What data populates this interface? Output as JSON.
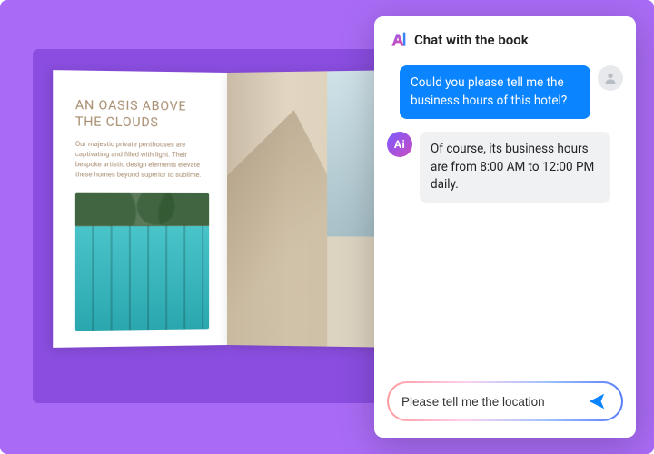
{
  "book": {
    "title": "AN OASIS ABOVE THE CLOUDS",
    "body": "Our majestic private penthouses are captivating and filled with light. Their bespoke artistic design elements elevate these homes beyond superior to sublime."
  },
  "chat": {
    "title": "Chat with the book",
    "messages": {
      "user1": "Could you please tell me the business hours of this hotel?",
      "ai1": "Of course, its business hours are from 8:00 AM to 12:00 PM daily."
    },
    "input_value": "Please tell me the location",
    "ai_badge": "Ai"
  },
  "colors": {
    "bg": "#a96bf5",
    "accent_blue": "#0a84ff"
  }
}
